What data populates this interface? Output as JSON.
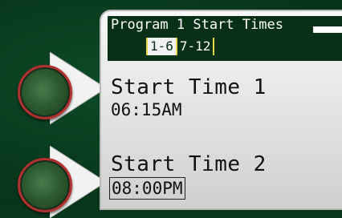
{
  "screen": {
    "title": "Program 1 Start Times",
    "tabs": [
      {
        "label": "1-6",
        "active": true
      },
      {
        "label": "7-12",
        "active": false
      }
    ],
    "entries": [
      {
        "label": "Start Time 1",
        "value": "06:15AM",
        "selected": false
      },
      {
        "label": "Start Time 2",
        "value": "08:00PM",
        "selected": true
      }
    ]
  },
  "colors": {
    "bezel": "#08371c",
    "header": "#073017",
    "tab_separator": "#e7d64a",
    "softkey_ring": "#b3302e"
  }
}
